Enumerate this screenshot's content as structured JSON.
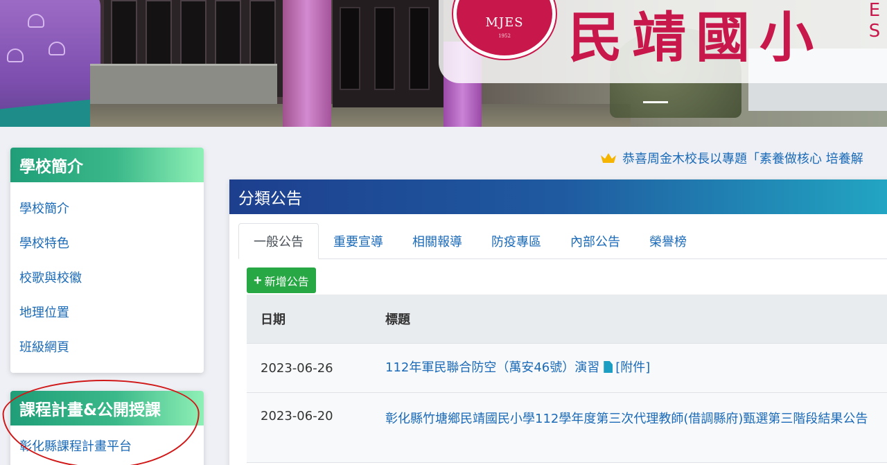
{
  "banner": {
    "seal_text": "MJES",
    "seal_year": "1952",
    "school_name": "民靖國小",
    "school_abbr_letters": "E S"
  },
  "sidebar": {
    "intro": {
      "title": "學校簡介",
      "items": [
        {
          "label": "學校簡介"
        },
        {
          "label": "學校特色"
        },
        {
          "label": "校歌與校徽"
        },
        {
          "label": "地理位置"
        },
        {
          "label": "班級網頁"
        }
      ]
    },
    "curriculum": {
      "title": "課程計畫&公開授課",
      "items": [
        {
          "label": "彰化縣課程計畫平台"
        }
      ]
    }
  },
  "marquee": {
    "icon": "crown-icon",
    "text": "恭喜周金木校長以專題「素養做核心 培養解"
  },
  "announcements": {
    "title": "分類公告",
    "tabs": [
      {
        "label": "一般公告",
        "active": true
      },
      {
        "label": "重要宣導",
        "active": false
      },
      {
        "label": "相關報導",
        "active": false
      },
      {
        "label": "防疫專區",
        "active": false
      },
      {
        "label": "內部公告",
        "active": false
      },
      {
        "label": "榮譽榜",
        "active": false
      }
    ],
    "add_button": "新增公告",
    "columns": {
      "date": "日期",
      "title": "標題"
    },
    "rows": [
      {
        "date": "2023-06-26",
        "title": "112年軍民聯合防空（萬安46號）演習",
        "attachment": "[附件]"
      },
      {
        "date": "2023-06-20",
        "title": "彰化縣竹塘鄉民靖國民小學112學年度第三次代理教師(借調縣府)甄選第三階段結果公告"
      }
    ]
  },
  "colors": {
    "accent_green": "#28a745",
    "link_blue": "#1b6ab8",
    "brand_red": "#c8174a",
    "annotation_red": "#d01818"
  }
}
